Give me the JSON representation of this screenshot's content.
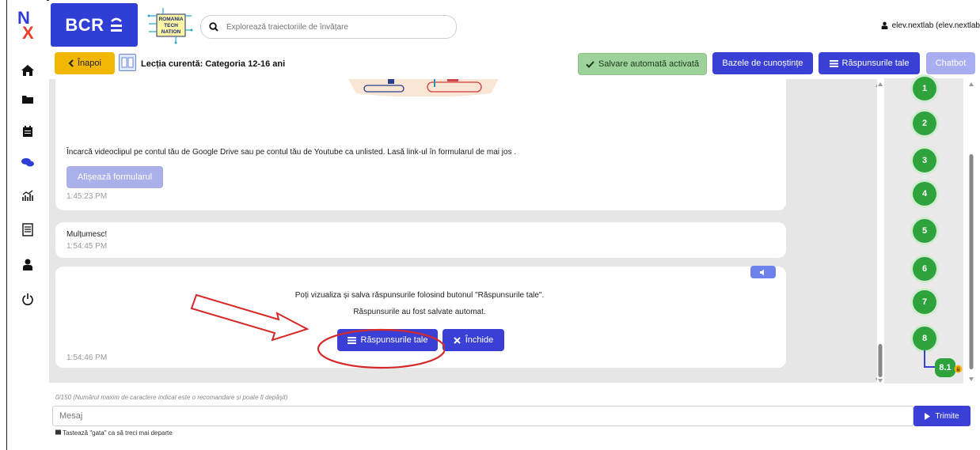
{
  "header": {
    "brand": "BCR",
    "partner_lines": [
      "ROMANIA",
      "TECH",
      "NATION"
    ],
    "search_placeholder": "Explorează traiectoriile de învățare",
    "user": "elev.nextlab (elev.nextlab"
  },
  "toolbar": {
    "back_label": "Înapoi",
    "lesson_title": "Lecția curentă: Categoria 12-16 ani",
    "autosave_label": "Salvare automată activată",
    "knowledge_label": "Bazele de cunoștințe",
    "answers_label": "Răspunsurile tale",
    "chatbot_label": "Chatbot"
  },
  "sidebar": {
    "icons": [
      "home-icon",
      "folder-icon",
      "calendar-icon",
      "chat-icon",
      "stats-icon",
      "report-icon",
      "user-icon",
      "power-icon"
    ]
  },
  "messages": [
    {
      "text": "Încarcă videoclipul pe contul tău de Google Drive sau pe contul tău de Youtube ca unlisted. Lasă link-ul în formularul de mai jos .",
      "button": "Afișează formularul",
      "time": "1:45:23 PM"
    },
    {
      "text": "Mulțumesc!",
      "time": "1:54:45 PM"
    },
    {
      "line1": "Poți vizualiza și salva răspunsurile folosind butonul \"Răspunsurile tale\".",
      "line2": "Răspunsurile au fost salvate automat.",
      "answers_button": "Răspunsurile tale",
      "close_button": "Închide",
      "time": "1:54:46 PM"
    }
  ],
  "steps": [
    "1",
    "2",
    "3",
    "4",
    "5",
    "6",
    "7",
    "8"
  ],
  "substep": "8.1",
  "input": {
    "counter": "0/150 (Numărul maxim de caractere indicat este o recomandare și poate fi depășit)",
    "placeholder": "Mesaj",
    "send_label": "Trimite",
    "hint": "Tastează \"gata\" ca să treci mai departe"
  },
  "colors": {
    "primary": "#3a3fd6",
    "success": "#2ea33b",
    "warning": "#f2b705",
    "annotation": "#d62828"
  }
}
